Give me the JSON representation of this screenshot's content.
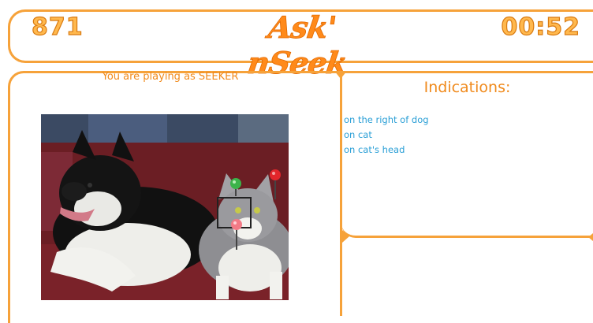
{
  "header": {
    "score": "871",
    "logo": "Ask' nSeek",
    "timer": "00:52"
  },
  "game": {
    "role_text": "You are playing as SEEKER"
  },
  "indications": {
    "title": "Indications:",
    "items": [
      "on the right of dog",
      "on cat",
      "on cat's head"
    ]
  },
  "photo": {
    "subjects": [
      "dog",
      "cat"
    ],
    "markers": [
      "green-pin",
      "red-pin",
      "red-pin"
    ]
  },
  "colors": {
    "accent": "#f6a23a",
    "title_orange": "#f08a1c",
    "hint_blue": "#2a9fd6",
    "couch": "#6b1e24"
  }
}
